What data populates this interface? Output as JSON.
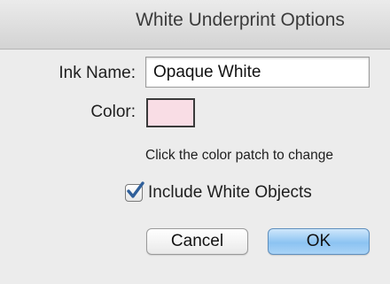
{
  "dialog": {
    "title": "White Underprint Options",
    "ink_name_label": "Ink Name:",
    "ink_name_value": "Opaque White",
    "color_label": "Color:",
    "color_patch_color": "#f9dde5",
    "color_hint": "Click the color patch to change",
    "include_white_objects": {
      "label": "Include White Objects",
      "checked": true
    },
    "buttons": {
      "cancel": "Cancel",
      "ok": "OK"
    }
  },
  "colors": {
    "window_background": "#ececec",
    "checkmark": "#2f5f9a",
    "default_button": "#8cc3f2"
  }
}
